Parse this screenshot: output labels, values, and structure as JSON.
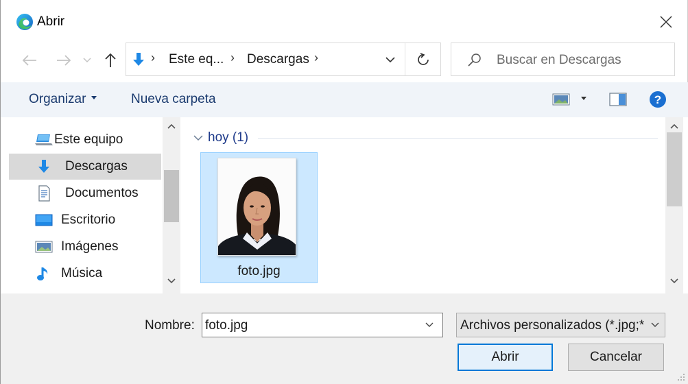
{
  "window": {
    "title": "Abrir",
    "close_glyph": "✕"
  },
  "address_bar": {
    "segments": [
      "Este eq...",
      "Descargas"
    ],
    "separator": "›",
    "location_icon": "download-arrow-icon"
  },
  "search": {
    "placeholder": "Buscar en Descargas"
  },
  "toolbar": {
    "organize_label": "Organizar",
    "new_folder_label": "Nueva carpeta",
    "help_glyph": "?"
  },
  "nav_pane": {
    "items": [
      {
        "label": "Este equipo",
        "icon": "computer-icon",
        "selected": false
      },
      {
        "label": "Descargas",
        "icon": "download-arrow-icon",
        "selected": true
      },
      {
        "label": "Documentos",
        "icon": "document-icon",
        "selected": false
      },
      {
        "label": "Escritorio",
        "icon": "desktop-icon",
        "selected": false
      },
      {
        "label": "Imágenes",
        "icon": "pictures-icon",
        "selected": false
      },
      {
        "label": "Música",
        "icon": "music-note-icon",
        "selected": false
      }
    ]
  },
  "files": {
    "group_label": "hoy (1)",
    "items": [
      {
        "name": "foto.jpg",
        "selected": true
      }
    ]
  },
  "footer": {
    "name_label": "Nombre:",
    "name_value": "foto.jpg",
    "file_type": "Archivos personalizados (*.jpg;*",
    "open_label": "Abrir",
    "cancel_label": "Cancelar"
  },
  "colors": {
    "accent": "#0078d7",
    "selection": "#cce8ff",
    "toolbar_bg": "#f0f4f9",
    "link_text": "#1b3b6f",
    "group_text": "#1e3a8a"
  }
}
